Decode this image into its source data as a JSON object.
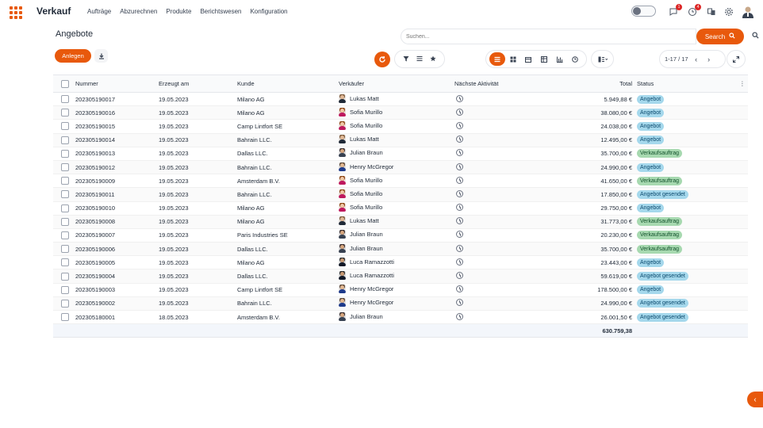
{
  "app": {
    "brand": "Verkauf"
  },
  "menu": [
    "Aufträge",
    "Abzurechnen",
    "Produkte",
    "Berichtswesen",
    "Konfiguration"
  ],
  "nav": {
    "badge_messages": "1",
    "badge_activities": "4"
  },
  "page": {
    "title": "Angebote"
  },
  "search": {
    "placeholder": "Suchen...",
    "button_label": "Search"
  },
  "actions": {
    "create_label": "Anlegen"
  },
  "pager": {
    "value": "1-17 / 17"
  },
  "table": {
    "headers": {
      "number": "Nummer",
      "created": "Erzeugt am",
      "customer": "Kunde",
      "salesperson": "Verkäufer",
      "activity": "Nächste Aktivität",
      "total": "Total",
      "status": "Status"
    },
    "rows": [
      {
        "number": "202305190017",
        "date": "19.05.2023",
        "customer": "Milano AG",
        "salesperson": "Lukas Matt",
        "avatar": "m1",
        "total": "5.949,88 €",
        "status": "Angebot",
        "status_type": "info"
      },
      {
        "number": "202305190016",
        "date": "19.05.2023",
        "customer": "Milano AG",
        "salesperson": "Sofia Murillo",
        "avatar": "f1",
        "total": "38.080,00 €",
        "status": "Angebot",
        "status_type": "info"
      },
      {
        "number": "202305190015",
        "date": "19.05.2023",
        "customer": "Camp Lintfort SE",
        "salesperson": "Sofia Murillo",
        "avatar": "f1",
        "total": "24.038,00 €",
        "status": "Angebot",
        "status_type": "info"
      },
      {
        "number": "202305190014",
        "date": "19.05.2023",
        "customer": "Bahrain LLC.",
        "salesperson": "Lukas Matt",
        "avatar": "m1",
        "total": "12.495,00 €",
        "status": "Angebot",
        "status_type": "info"
      },
      {
        "number": "202305190013",
        "date": "19.05.2023",
        "customer": "Dallas LLC.",
        "salesperson": "Julian Braun",
        "avatar": "m2",
        "total": "35.700,00 €",
        "status": "Verkaufsauftrag",
        "status_type": "success"
      },
      {
        "number": "202305190012",
        "date": "19.05.2023",
        "customer": "Bahrain LLC.",
        "salesperson": "Henry McGregor",
        "avatar": "m3",
        "total": "24.990,00 €",
        "status": "Angebot",
        "status_type": "info"
      },
      {
        "number": "202305190009",
        "date": "19.05.2023",
        "customer": "Amsterdam B.V.",
        "salesperson": "Sofia Murillo",
        "avatar": "f1",
        "total": "41.650,00 €",
        "status": "Verkaufsauftrag",
        "status_type": "success"
      },
      {
        "number": "202305190011",
        "date": "19.05.2023",
        "customer": "Bahrain LLC.",
        "salesperson": "Sofia Murillo",
        "avatar": "f1",
        "total": "17.850,00 €",
        "status": "Angebot gesendet",
        "status_type": "info"
      },
      {
        "number": "202305190010",
        "date": "19.05.2023",
        "customer": "Milano AG",
        "salesperson": "Sofia Murillo",
        "avatar": "f1",
        "total": "29.750,00 €",
        "status": "Angebot",
        "status_type": "info"
      },
      {
        "number": "202305190008",
        "date": "19.05.2023",
        "customer": "Milano AG",
        "salesperson": "Lukas Matt",
        "avatar": "m1",
        "total": "31.773,00 €",
        "status": "Verkaufsauftrag",
        "status_type": "success"
      },
      {
        "number": "202305190007",
        "date": "19.05.2023",
        "customer": "Paris Industries SE",
        "salesperson": "Julian Braun",
        "avatar": "m2",
        "total": "20.230,00 €",
        "status": "Verkaufsauftrag",
        "status_type": "success"
      },
      {
        "number": "202305190006",
        "date": "19.05.2023",
        "customer": "Dallas LLC.",
        "salesperson": "Julian Braun",
        "avatar": "m2",
        "total": "35.700,00 €",
        "status": "Verkaufsauftrag",
        "status_type": "success"
      },
      {
        "number": "202305190005",
        "date": "19.05.2023",
        "customer": "Milano AG",
        "salesperson": "Luca Ramazzotti",
        "avatar": "m4",
        "total": "23.443,00 €",
        "status": "Angebot",
        "status_type": "info"
      },
      {
        "number": "202305190004",
        "date": "19.05.2023",
        "customer": "Dallas LLC.",
        "salesperson": "Luca Ramazzotti",
        "avatar": "m4",
        "total": "59.619,00 €",
        "status": "Angebot gesendet",
        "status_type": "info"
      },
      {
        "number": "202305190003",
        "date": "19.05.2023",
        "customer": "Camp Lintfort SE",
        "salesperson": "Henry McGregor",
        "avatar": "m3",
        "total": "178.500,00 €",
        "status": "Angebot",
        "status_type": "info"
      },
      {
        "number": "202305190002",
        "date": "19.05.2023",
        "customer": "Bahrain LLC.",
        "salesperson": "Henry McGregor",
        "avatar": "m3",
        "total": "24.990,00 €",
        "status": "Angebot gesendet",
        "status_type": "info"
      },
      {
        "number": "202305180001",
        "date": "18.05.2023",
        "customer": "Amsterdam B.V.",
        "salesperson": "Julian Braun",
        "avatar": "m2",
        "total": "26.001,50 €",
        "status": "Angebot gesendet",
        "status_type": "info"
      }
    ],
    "footer_total": "630.759,38"
  },
  "colors": {
    "accent": "#e8590c",
    "status_info": "#a5d8ec",
    "status_success": "#a7d9b0"
  },
  "icons": {
    "apps": "apps-grid-icon",
    "messages": "chat-icon",
    "activities": "clock-icon",
    "refresh": "refresh-icon",
    "filter": "filter-icon",
    "group": "group-by-icon",
    "favorite": "star-icon"
  }
}
